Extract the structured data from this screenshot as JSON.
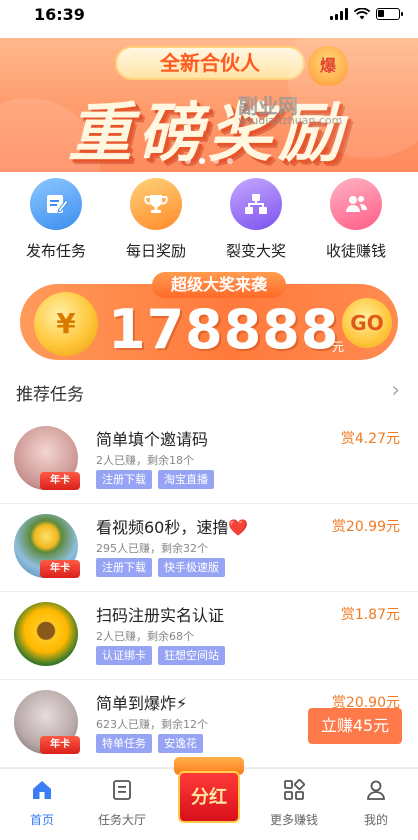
{
  "status_bar": {
    "time": "16:39",
    "battery_level": 0.3
  },
  "banner": {
    "subtitle": "全新合伙人",
    "badge": "爆",
    "title": "重磅奖励",
    "watermark": "副业网",
    "watermark_url": "youdianzhuan.com",
    "dots_count": 4,
    "active_dot": 1
  },
  "quick_actions": [
    {
      "label": "发布任务",
      "icon": "publish-task-icon",
      "color": "#4aa3f0"
    },
    {
      "label": "每日奖励",
      "icon": "trophy-icon",
      "color": "#ffa13a"
    },
    {
      "label": "裂变大奖",
      "icon": "network-icon",
      "color": "#9b73f0"
    },
    {
      "label": "收徒赚钱",
      "icon": "users-icon",
      "color": "#ff7a9a"
    }
  ],
  "prize": {
    "tag": "超级大奖来袭",
    "coin_symbol": "¥",
    "amount": "178888",
    "unit": "元",
    "go_label": "GO"
  },
  "section": {
    "title": "推荐任务",
    "chevron": "›"
  },
  "tasks": [
    {
      "title": "简单填个邀请码",
      "earned": "2人已赚，剩余18个",
      "tags": [
        "注册下载",
        "淘宝直播"
      ],
      "reward": "赏4.27元",
      "ribbon": "年卡",
      "avatar_color": "#d9b3b0"
    },
    {
      "title": "看视频60秒，速撸❤️",
      "earned": "295人已赚，剩余32个",
      "tags": [
        "注册下载",
        "快手极速版"
      ],
      "reward": "赏20.99元",
      "ribbon": "年卡",
      "avatar_color": "#6fa0c8"
    },
    {
      "title": "扫码注册实名认证",
      "earned": "2人已赚，剩余68个",
      "tags": [
        "认证绑卡",
        "狂想空间站"
      ],
      "reward": "赏1.87元",
      "ribbon": "",
      "avatar_color": "#f5c21a"
    },
    {
      "title": "简单到爆炸⚡",
      "earned": "623人已赚，剩余12个",
      "tags": [
        "特单任务",
        "安逸花"
      ],
      "reward": "赏20.90元",
      "ribbon": "年卡",
      "avatar_color": "#b8a9a8"
    }
  ],
  "cta": {
    "label": "立赚45元"
  },
  "tabbar": {
    "tabs": [
      {
        "label": "首页",
        "icon": "home-icon",
        "active": true
      },
      {
        "label": "任务大厅",
        "icon": "task-hall-icon",
        "active": false
      },
      {
        "label": "更多赚钱",
        "icon": "grid-icon",
        "active": false
      },
      {
        "label": "我的",
        "icon": "profile-icon",
        "active": false
      }
    ],
    "center_label": "分红"
  }
}
